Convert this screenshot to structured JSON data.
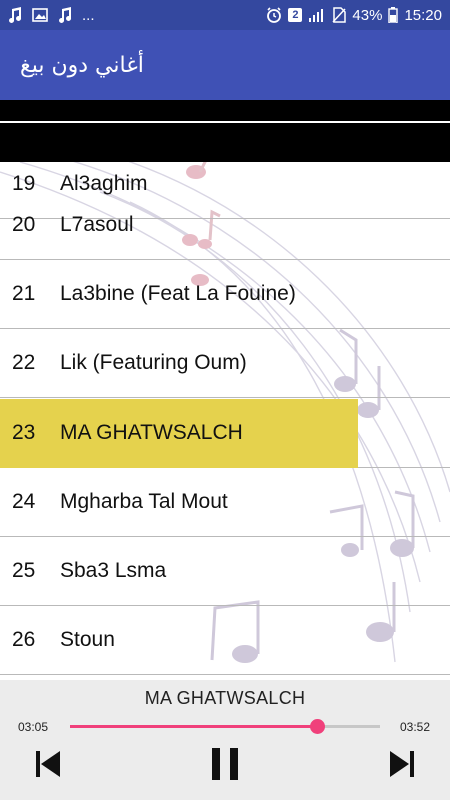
{
  "status_bar": {
    "notif_icons": [
      "music-note-icon",
      "image-icon",
      "music-note-icon"
    ],
    "more": "...",
    "sim_badge": "2",
    "battery": "43%",
    "time": "15:20"
  },
  "app_bar": {
    "title": "أغاني دون بيغ"
  },
  "songs": [
    {
      "num": "20",
      "title": "L7asoul"
    },
    {
      "num": "21",
      "title": "La3bine (Feat La Fouine)"
    },
    {
      "num": "22",
      "title": "Lik (Featuring Oum)"
    },
    {
      "num": "23",
      "title": "MA GHATWSALCH"
    },
    {
      "num": "24",
      "title": "Mgharba Tal Mout"
    },
    {
      "num": "25",
      "title": "Sba3 Lsma"
    },
    {
      "num": "26",
      "title": "Stoun"
    }
  ],
  "active_song_index": 3,
  "player": {
    "now_playing": "MA GHATWSALCH",
    "elapsed": "03:05",
    "duration": "03:52",
    "progress_fraction": 0.797
  },
  "colors": {
    "status_bar": "#34489f",
    "app_bar": "#3f51b5",
    "highlight": "#e5d24d",
    "accent": "#f0407b"
  }
}
